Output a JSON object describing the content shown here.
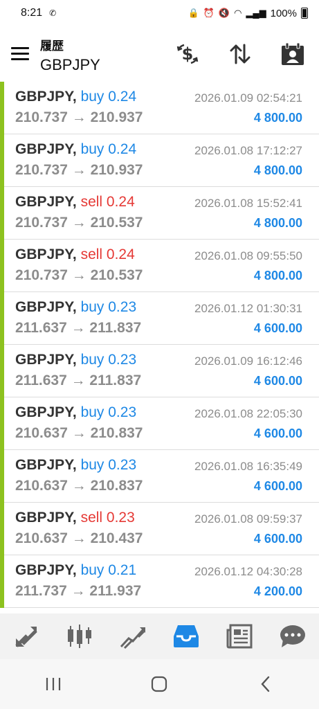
{
  "status_bar": {
    "time": "8:21",
    "battery": "100%"
  },
  "header": {
    "subtitle": "履歴",
    "title": "GBPJPY"
  },
  "trades": [
    {
      "symbol": "GBPJPY,",
      "side": "buy",
      "side_label": "buy 0.24",
      "prices": "210.737 → 210.937",
      "time": "2026.01.09 02:54:21",
      "profit": "4 800.00"
    },
    {
      "symbol": "GBPJPY,",
      "side": "buy",
      "side_label": "buy 0.24",
      "prices": "210.737 → 210.937",
      "time": "2026.01.08 17:12:27",
      "profit": "4 800.00"
    },
    {
      "symbol": "GBPJPY,",
      "side": "sell",
      "side_label": "sell 0.24",
      "prices": "210.737 → 210.537",
      "time": "2026.01.08 15:52:41",
      "profit": "4 800.00"
    },
    {
      "symbol": "GBPJPY,",
      "side": "sell",
      "side_label": "sell 0.24",
      "prices": "210.737 → 210.537",
      "time": "2026.01.08 09:55:50",
      "profit": "4 800.00"
    },
    {
      "symbol": "GBPJPY,",
      "side": "buy",
      "side_label": "buy 0.23",
      "prices": "211.637 → 211.837",
      "time": "2026.01.12 01:30:31",
      "profit": "4 600.00"
    },
    {
      "symbol": "GBPJPY,",
      "side": "buy",
      "side_label": "buy 0.23",
      "prices": "211.637 → 211.837",
      "time": "2026.01.09 16:12:46",
      "profit": "4 600.00"
    },
    {
      "symbol": "GBPJPY,",
      "side": "buy",
      "side_label": "buy 0.23",
      "prices": "210.637 → 210.837",
      "time": "2026.01.08 22:05:30",
      "profit": "4 600.00"
    },
    {
      "symbol": "GBPJPY,",
      "side": "buy",
      "side_label": "buy 0.23",
      "prices": "210.637 → 210.837",
      "time": "2026.01.08 16:35:49",
      "profit": "4 600.00"
    },
    {
      "symbol": "GBPJPY,",
      "side": "sell",
      "side_label": "sell 0.23",
      "prices": "210.637 → 210.437",
      "time": "2026.01.08 09:59:37",
      "profit": "4 600.00"
    },
    {
      "symbol": "GBPJPY,",
      "side": "buy",
      "side_label": "buy 0.21",
      "prices": "211.737 → 211.937",
      "time": "2026.01.12 04:30:28",
      "profit": "4 200.00"
    }
  ],
  "colors": {
    "buy": "#1e88e5",
    "sell": "#e53935",
    "row_marker": "#8dc21f",
    "active_nav": "#1e88e5"
  },
  "nav_icons": [
    "trade-icon",
    "quotes-chart-icon",
    "chart-icon",
    "history-icon",
    "news-icon",
    "messages-icon"
  ]
}
